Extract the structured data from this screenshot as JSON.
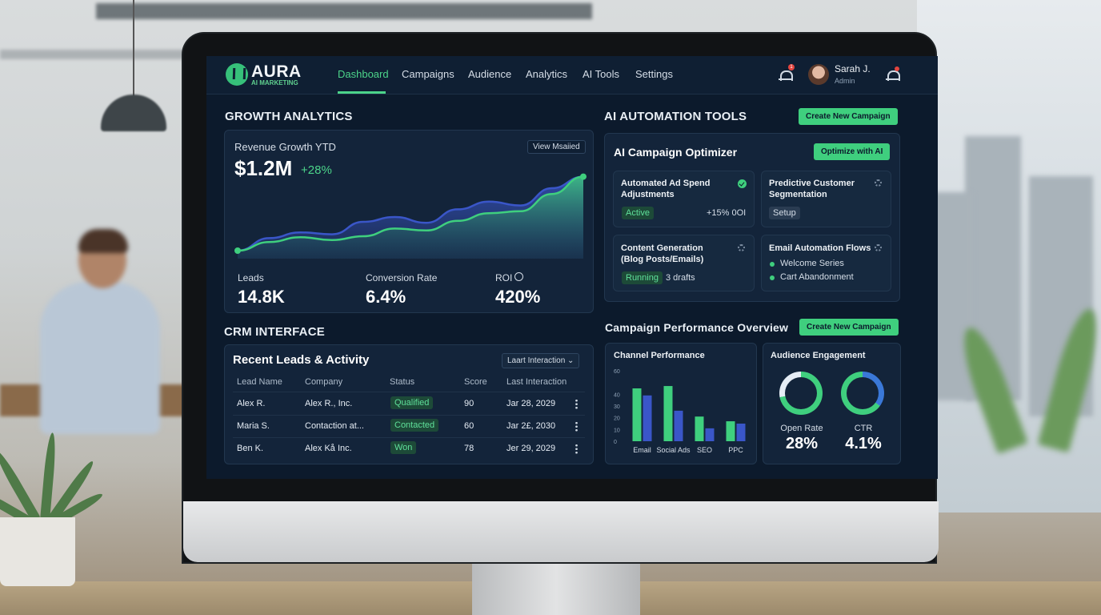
{
  "nav": {
    "brand": "AURA",
    "brand_sub": "AI MARKETING",
    "items": [
      {
        "label": "Dashboard",
        "active": true
      },
      {
        "label": "Campaigns"
      },
      {
        "label": "Audience"
      },
      {
        "label": "Analytics"
      },
      {
        "label": "AI Tools"
      },
      {
        "label": "Settings"
      }
    ],
    "notification_badge": "1",
    "user_name": "Sarah J.",
    "user_role": "Admin"
  },
  "growth": {
    "section_title": "GROWTH ANALYTICS",
    "chart_label": "Revenue Growth YTD",
    "view_button": "View Msaiied",
    "value": "$1.2M",
    "change": "+28%",
    "stats": [
      {
        "label": "Leads",
        "value": "14.8K"
      },
      {
        "label": "Conversion Rate",
        "value": "6.4%"
      },
      {
        "label": "ROI",
        "value": "420%"
      }
    ]
  },
  "ai_tools": {
    "section_title": "AI AUTOMATION TOOLS",
    "create_button": "Create New Campaign",
    "optimizer_title": "AI Campaign Optimizer",
    "optimize_button": "Optimize with AI",
    "tools": [
      {
        "title_1": "Automated Ad Spend",
        "title_2": "Adjustments",
        "status": "Active",
        "extra": "+15% 0OI"
      },
      {
        "title_1": "Predictive Customer",
        "title_2": "Segmentation",
        "status": "Setup"
      },
      {
        "title_1": "Content Generation",
        "title_2": "(Blog Posts/Emails)",
        "status": "Running",
        "extra": "3 drafts"
      },
      {
        "title_1": "Email Automation Flows",
        "items": [
          "Welcome Series",
          "Cart Abandonment"
        ]
      }
    ]
  },
  "crm": {
    "section_title": "CRM INTERFACE",
    "table_title": "Recent Leads & Activity",
    "sort_dropdown": "Laart Interaction",
    "columns": [
      "Lead Name",
      "Company",
      "Status",
      "Score",
      "Last Interaction"
    ],
    "rows": [
      {
        "name": "Alex R.",
        "company": "Alex R., Inc.",
        "status": "Qualified",
        "score": "90",
        "last": "Jar 28, 2029"
      },
      {
        "name": "Maria S.",
        "company": "Contaction at...",
        "status": "Contacted",
        "score": "60",
        "last": "Jar 2£, 2030"
      },
      {
        "name": "Ben K.",
        "company": "Alex Kå Inc.",
        "status": "Won",
        "score": "78",
        "last": "Jer 29, 2029"
      }
    ]
  },
  "campaign": {
    "section_title": "Campaign Performance Overview",
    "create_button": "Create New Campaign",
    "channel_title": "Channel Performance",
    "engagement_title": "Audience Engagement",
    "open_rate_label": "Open Rate",
    "open_rate_value": "28%",
    "ctr_label": "CTR",
    "ctr_value": "4.1%"
  },
  "chart_data": [
    {
      "type": "area",
      "title": "Revenue Growth YTD",
      "xlabel": "",
      "ylabel": "",
      "x": [
        0,
        1,
        2,
        3,
        4,
        5,
        6,
        7,
        8,
        9,
        10,
        11
      ],
      "series": [
        {
          "values": [
            5,
            18,
            24,
            22,
            35,
            40,
            34,
            48,
            56,
            52,
            70,
            82
          ],
          "color": "#3a56c8"
        },
        {
          "values": [
            5,
            14,
            19,
            16,
            20,
            28,
            26,
            36,
            44,
            46,
            64,
            82
          ],
          "color": "#3fcf7e"
        }
      ],
      "ylim": [
        0,
        100
      ]
    },
    {
      "type": "bar",
      "title": "Channel Performance",
      "categories": [
        "Email",
        "Social Ads",
        "SEO",
        "PPC"
      ],
      "series": [
        {
          "values": [
            45,
            47,
            21,
            17
          ],
          "color": "#3fcf7e"
        },
        {
          "values": [
            39,
            26,
            11,
            15
          ],
          "color": "#3a56c8"
        }
      ],
      "ylim": [
        0,
        60
      ],
      "yticks": [
        "0",
        "10",
        "20",
        "30",
        "40",
        "60"
      ],
      "grid": false
    },
    {
      "type": "pie",
      "title": "Audience Engagement",
      "categories": [
        "Open Rate",
        "CTR"
      ],
      "values": [
        28,
        4.1
      ],
      "colors": [
        "#3fcf7e",
        "#3a78d8"
      ]
    }
  ]
}
